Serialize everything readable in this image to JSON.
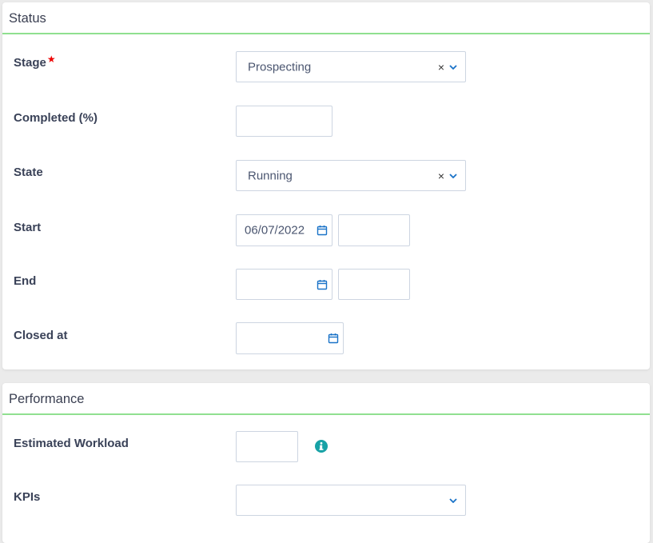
{
  "sections": {
    "status": {
      "title": "Status",
      "stage": {
        "label": "Stage",
        "required": "★",
        "value": "Prospecting"
      },
      "completed": {
        "label": "Completed (%)",
        "value": ""
      },
      "state": {
        "label": "State",
        "value": "Running"
      },
      "start": {
        "label": "Start",
        "date": "06/07/2022",
        "time": ""
      },
      "end": {
        "label": "End",
        "date": "",
        "time": ""
      },
      "closed_at": {
        "label": "Closed at",
        "date": ""
      }
    },
    "performance": {
      "title": "Performance",
      "estimated_workload": {
        "label": "Estimated Workload",
        "value": ""
      },
      "kpis": {
        "label": "KPIs",
        "value": ""
      }
    }
  },
  "icons": {
    "clear": "×",
    "accent": "#1a73c8",
    "info_color": "#17a2a6"
  }
}
